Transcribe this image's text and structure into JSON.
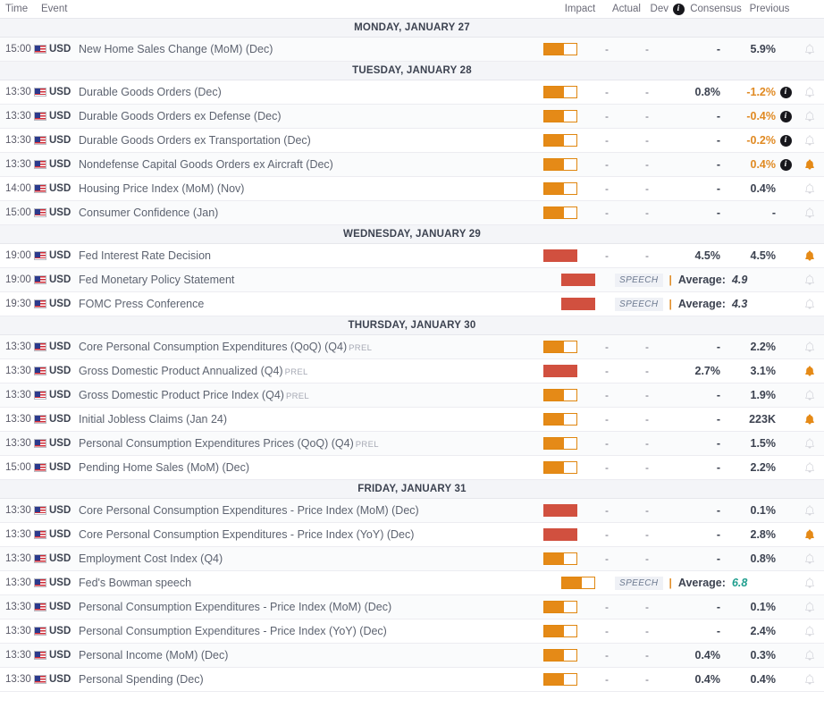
{
  "header": {
    "time": "Time",
    "event": "Event",
    "impact": "Impact",
    "actual": "Actual",
    "dev": "Dev",
    "info_icon": "i",
    "consensus": "Consensus",
    "previous": "Previous"
  },
  "colors": {
    "impact_medium": "#e58a17",
    "impact_high": "#d1503f",
    "bell_active": "#e58a17",
    "bell_inactive": "#d5d6dc",
    "revised_value": "#e08a23",
    "positive_value": "#1f9e8e",
    "day_header_bg": "#f4f5f8"
  },
  "days": [
    {
      "label": "MONDAY, JANUARY 27",
      "events": [
        {
          "time": "15:00",
          "currency": "USD",
          "flag": "us-flag-icon",
          "event": "New Home Sales Change (MoM) (Dec)",
          "prel": "",
          "impact": "medium",
          "impact_fill": 60,
          "actual": "-",
          "dev": "-",
          "consensus": "-",
          "previous": "5.9%",
          "revised": false,
          "has_info": false,
          "bell": "inactive",
          "type": "data"
        }
      ]
    },
    {
      "label": "TUESDAY, JANUARY 28",
      "events": [
        {
          "time": "13:30",
          "currency": "USD",
          "flag": "us-flag-icon",
          "event": "Durable Goods Orders (Dec)",
          "prel": "",
          "impact": "medium",
          "impact_fill": 60,
          "actual": "-",
          "dev": "-",
          "consensus": "0.8%",
          "previous": "-1.2%",
          "revised": true,
          "has_info": true,
          "bell": "inactive",
          "type": "data"
        },
        {
          "time": "13:30",
          "currency": "USD",
          "flag": "us-flag-icon",
          "event": "Durable Goods Orders ex Defense (Dec)",
          "prel": "",
          "impact": "medium",
          "impact_fill": 60,
          "actual": "-",
          "dev": "-",
          "consensus": "-",
          "previous": "-0.4%",
          "revised": true,
          "has_info": true,
          "bell": "inactive",
          "type": "data"
        },
        {
          "time": "13:30",
          "currency": "USD",
          "flag": "us-flag-icon",
          "event": "Durable Goods Orders ex Transportation (Dec)",
          "prel": "",
          "impact": "medium",
          "impact_fill": 60,
          "actual": "-",
          "dev": "-",
          "consensus": "-",
          "previous": "-0.2%",
          "revised": true,
          "has_info": true,
          "bell": "inactive",
          "type": "data"
        },
        {
          "time": "13:30",
          "currency": "USD",
          "flag": "us-flag-icon",
          "event": "Nondefense Capital Goods Orders ex Aircraft (Dec)",
          "prel": "",
          "impact": "medium",
          "impact_fill": 60,
          "actual": "-",
          "dev": "-",
          "consensus": "-",
          "previous": "0.4%",
          "revised": true,
          "has_info": true,
          "bell": "active",
          "type": "data"
        },
        {
          "time": "14:00",
          "currency": "USD",
          "flag": "us-flag-icon",
          "event": "Housing Price Index (MoM) (Nov)",
          "prel": "",
          "impact": "medium",
          "impact_fill": 60,
          "actual": "-",
          "dev": "-",
          "consensus": "-",
          "previous": "0.4%",
          "revised": false,
          "has_info": false,
          "bell": "inactive",
          "type": "data"
        },
        {
          "time": "15:00",
          "currency": "USD",
          "flag": "us-flag-icon",
          "event": "Consumer Confidence (Jan)",
          "prel": "",
          "impact": "medium",
          "impact_fill": 60,
          "actual": "-",
          "dev": "-",
          "consensus": "-",
          "previous": "-",
          "revised": false,
          "has_info": false,
          "bell": "inactive",
          "type": "data"
        }
      ]
    },
    {
      "label": "WEDNESDAY, JANUARY 29",
      "events": [
        {
          "time": "19:00",
          "currency": "USD",
          "flag": "us-flag-icon",
          "event": "Fed Interest Rate Decision",
          "prel": "",
          "impact": "high",
          "impact_fill": 100,
          "actual": "-",
          "dev": "-",
          "consensus": "4.5%",
          "previous": "4.5%",
          "revised": false,
          "has_info": false,
          "bell": "active",
          "type": "data"
        },
        {
          "time": "19:00",
          "currency": "USD",
          "flag": "us-flag-icon",
          "event": "Fed Monetary Policy Statement",
          "prel": "",
          "impact": "high",
          "impact_fill": 100,
          "speech_tag": "SPEECH",
          "avg_label": "Average:",
          "avg_value": "4.9",
          "avg_green": false,
          "bell": "inactive",
          "type": "speech"
        },
        {
          "time": "19:30",
          "currency": "USD",
          "flag": "us-flag-icon",
          "event": "FOMC Press Conference",
          "prel": "",
          "impact": "high",
          "impact_fill": 100,
          "speech_tag": "SPEECH",
          "avg_label": "Average:",
          "avg_value": "4.3",
          "avg_green": false,
          "bell": "inactive",
          "type": "speech"
        }
      ]
    },
    {
      "label": "THURSDAY, JANUARY 30",
      "events": [
        {
          "time": "13:30",
          "currency": "USD",
          "flag": "us-flag-icon",
          "event": "Core Personal Consumption Expenditures (QoQ) (Q4)",
          "prel": "PREL",
          "impact": "medium",
          "impact_fill": 60,
          "actual": "-",
          "dev": "-",
          "consensus": "-",
          "previous": "2.2%",
          "revised": false,
          "has_info": false,
          "bell": "inactive",
          "type": "data"
        },
        {
          "time": "13:30",
          "currency": "USD",
          "flag": "us-flag-icon",
          "event": "Gross Domestic Product Annualized (Q4)",
          "prel": "PREL",
          "impact": "high",
          "impact_fill": 100,
          "actual": "-",
          "dev": "-",
          "consensus": "2.7%",
          "previous": "3.1%",
          "revised": false,
          "has_info": false,
          "bell": "active",
          "type": "data"
        },
        {
          "time": "13:30",
          "currency": "USD",
          "flag": "us-flag-icon",
          "event": "Gross Domestic Product Price Index (Q4)",
          "prel": "PREL",
          "impact": "medium",
          "impact_fill": 60,
          "actual": "-",
          "dev": "-",
          "consensus": "-",
          "previous": "1.9%",
          "revised": false,
          "has_info": false,
          "bell": "inactive",
          "type": "data"
        },
        {
          "time": "13:30",
          "currency": "USD",
          "flag": "us-flag-icon",
          "event": "Initial Jobless Claims (Jan 24)",
          "prel": "",
          "impact": "medium",
          "impact_fill": 60,
          "actual": "-",
          "dev": "-",
          "consensus": "-",
          "previous": "223K",
          "revised": false,
          "has_info": false,
          "bell": "active",
          "type": "data"
        },
        {
          "time": "13:30",
          "currency": "USD",
          "flag": "us-flag-icon",
          "event": "Personal Consumption Expenditures Prices (QoQ) (Q4)",
          "prel": "PREL",
          "impact": "medium",
          "impact_fill": 60,
          "actual": "-",
          "dev": "-",
          "consensus": "-",
          "previous": "1.5%",
          "revised": false,
          "has_info": false,
          "bell": "inactive",
          "type": "data"
        },
        {
          "time": "15:00",
          "currency": "USD",
          "flag": "us-flag-icon",
          "event": "Pending Home Sales (MoM) (Dec)",
          "prel": "",
          "impact": "medium",
          "impact_fill": 60,
          "actual": "-",
          "dev": "-",
          "consensus": "-",
          "previous": "2.2%",
          "revised": false,
          "has_info": false,
          "bell": "inactive",
          "type": "data"
        }
      ]
    },
    {
      "label": "FRIDAY, JANUARY 31",
      "events": [
        {
          "time": "13:30",
          "currency": "USD",
          "flag": "us-flag-icon",
          "event": "Core Personal Consumption Expenditures - Price Index (MoM) (Dec)",
          "prel": "",
          "impact": "high",
          "impact_fill": 100,
          "actual": "-",
          "dev": "-",
          "consensus": "-",
          "previous": "0.1%",
          "revised": false,
          "has_info": false,
          "bell": "inactive",
          "type": "data"
        },
        {
          "time": "13:30",
          "currency": "USD",
          "flag": "us-flag-icon",
          "event": "Core Personal Consumption Expenditures - Price Index (YoY) (Dec)",
          "prel": "",
          "impact": "high",
          "impact_fill": 100,
          "actual": "-",
          "dev": "-",
          "consensus": "-",
          "previous": "2.8%",
          "revised": false,
          "has_info": false,
          "bell": "active",
          "type": "data"
        },
        {
          "time": "13:30",
          "currency": "USD",
          "flag": "us-flag-icon",
          "event": "Employment Cost Index (Q4)",
          "prel": "",
          "impact": "medium",
          "impact_fill": 60,
          "actual": "-",
          "dev": "-",
          "consensus": "-",
          "previous": "0.8%",
          "revised": false,
          "has_info": false,
          "bell": "inactive",
          "type": "data"
        },
        {
          "time": "13:30",
          "currency": "USD",
          "flag": "us-flag-icon",
          "event": "Fed's Bowman speech",
          "prel": "",
          "impact": "medium",
          "impact_fill": 60,
          "speech_tag": "SPEECH",
          "avg_label": "Average:",
          "avg_value": "6.8",
          "avg_green": true,
          "bell": "inactive",
          "type": "speech"
        },
        {
          "time": "13:30",
          "currency": "USD",
          "flag": "us-flag-icon",
          "event": "Personal Consumption Expenditures - Price Index (MoM) (Dec)",
          "prel": "",
          "impact": "medium",
          "impact_fill": 60,
          "actual": "-",
          "dev": "-",
          "consensus": "-",
          "previous": "0.1%",
          "revised": false,
          "has_info": false,
          "bell": "inactive",
          "type": "data"
        },
        {
          "time": "13:30",
          "currency": "USD",
          "flag": "us-flag-icon",
          "event": "Personal Consumption Expenditures - Price Index (YoY) (Dec)",
          "prel": "",
          "impact": "medium",
          "impact_fill": 60,
          "actual": "-",
          "dev": "-",
          "consensus": "-",
          "previous": "2.4%",
          "revised": false,
          "has_info": false,
          "bell": "inactive",
          "type": "data"
        },
        {
          "time": "13:30",
          "currency": "USD",
          "flag": "us-flag-icon",
          "event": "Personal Income (MoM) (Dec)",
          "prel": "",
          "impact": "medium",
          "impact_fill": 60,
          "actual": "-",
          "dev": "-",
          "consensus": "0.4%",
          "previous": "0.3%",
          "revised": false,
          "has_info": false,
          "bell": "inactive",
          "type": "data"
        },
        {
          "time": "13:30",
          "currency": "USD",
          "flag": "us-flag-icon",
          "event": "Personal Spending (Dec)",
          "prel": "",
          "impact": "medium",
          "impact_fill": 60,
          "actual": "-",
          "dev": "-",
          "consensus": "0.4%",
          "previous": "0.4%",
          "revised": false,
          "has_info": false,
          "bell": "inactive",
          "type": "data"
        }
      ]
    }
  ]
}
